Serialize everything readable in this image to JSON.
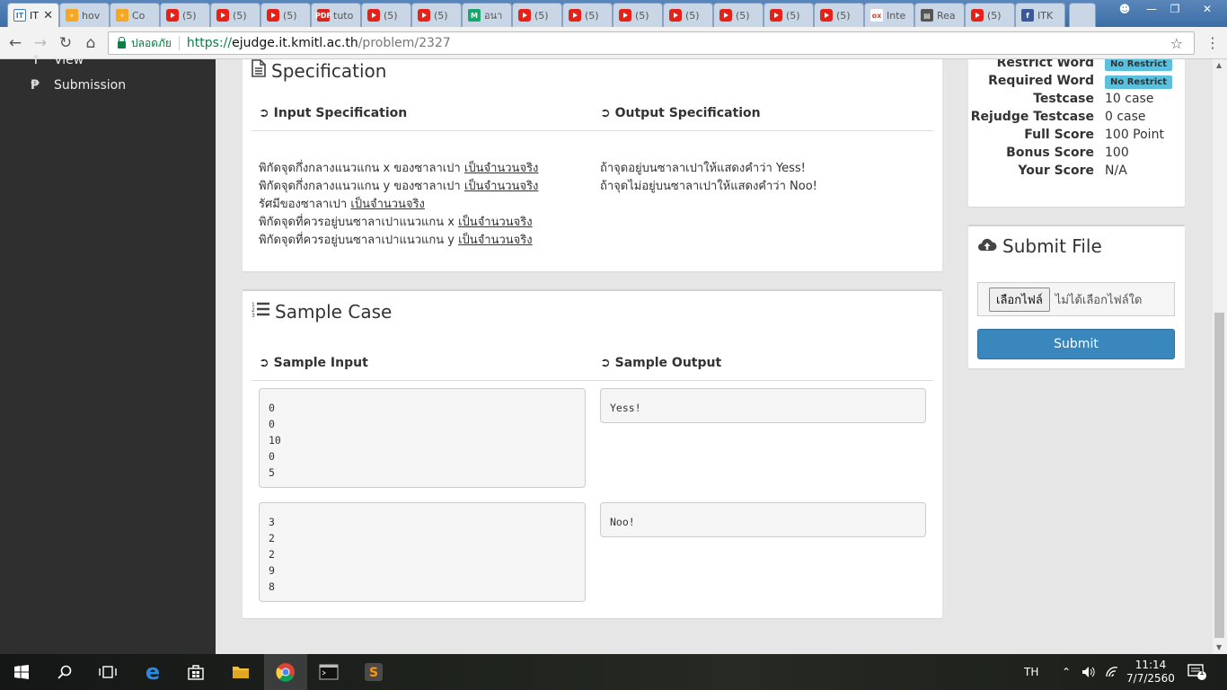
{
  "browser": {
    "tabs": [
      {
        "title": "IT",
        "icon": "it-icon",
        "active": true
      },
      {
        "title": "hov",
        "icon": "orange-icon"
      },
      {
        "title": "Co",
        "icon": "orange-icon"
      },
      {
        "title": "(5)",
        "icon": "youtube-icon"
      },
      {
        "title": "(5)",
        "icon": "youtube-icon"
      },
      {
        "title": "(5)",
        "icon": "youtube-icon"
      },
      {
        "title": "tuto",
        "icon": "pdf-icon"
      },
      {
        "title": "(5)",
        "icon": "youtube-icon"
      },
      {
        "title": "(5)",
        "icon": "youtube-icon"
      },
      {
        "title": "อนา",
        "icon": "medium-icon"
      },
      {
        "title": "(5)",
        "icon": "youtube-icon"
      },
      {
        "title": "(5)",
        "icon": "youtube-icon"
      },
      {
        "title": "(5)",
        "icon": "youtube-icon"
      },
      {
        "title": "(5)",
        "icon": "youtube-icon"
      },
      {
        "title": "(5)",
        "icon": "youtube-icon"
      },
      {
        "title": "(5)",
        "icon": "youtube-icon"
      },
      {
        "title": "(5)",
        "icon": "youtube-icon"
      },
      {
        "title": "Inte",
        "icon": "ox-icon"
      },
      {
        "title": "Rea",
        "icon": "doc-icon"
      },
      {
        "title": "(5)",
        "icon": "youtube-icon"
      },
      {
        "title": "ITK",
        "icon": "facebook-icon"
      }
    ],
    "secure_label": "ปลอดภัย",
    "url_scheme": "https://",
    "url_host": "ejudge.it.kmitl.ac.th",
    "url_path": "/problem/2327"
  },
  "sidebar": {
    "items": [
      {
        "icon": "view-icon",
        "label": "View"
      },
      {
        "icon": "p-icon",
        "label": "Submission"
      }
    ]
  },
  "specification": {
    "title": "Specification",
    "input_header": "Input Specification",
    "output_header": "Output Specification",
    "input_lines": [
      {
        "text": "พิกัดจุดกึ่งกลางแนวแกน x ของซาลาเปา ",
        "u": "เป็นจำนวนจริง"
      },
      {
        "text": "พิกัดจุดกึ่งกลางแนวแกน y ของซาลาเปา ",
        "u": "เป็นจำนวนจริง"
      },
      {
        "text": "รัศมีของซาลาเปา ",
        "u": "เป็นจำนวนจริง"
      },
      {
        "text": "พิกัดจุดที่ควรอยู่บนซาลาเปาแนวแกน x ",
        "u": "เป็นจำนวนจริง"
      },
      {
        "text": "พิกัดจุดที่ควรอยู่บนซาลาเปาแนวแกน y ",
        "u": "เป็นจำนวนจริง"
      }
    ],
    "output_lines": [
      "ถ้าจุดอยู่บนซาลาเปาให้แสดงคำว่า Yess!",
      "ถ้าจุดไม่อยู่บนซาลาเปาให้แสดงคำว่า Noo!"
    ]
  },
  "sample": {
    "title": "Sample Case",
    "input_header": "Sample Input",
    "output_header": "Sample Output",
    "cases": [
      {
        "input": "0\n0\n10\n0\n5",
        "output": "Yess!"
      },
      {
        "input": "3\n2\n2\n9\n8",
        "output": "Noo!"
      }
    ]
  },
  "info": {
    "rows": [
      {
        "label": "Restrict Word",
        "value": "No Restrict",
        "badge": true
      },
      {
        "label": "Required Word",
        "value": "No Restrict",
        "badge": true
      },
      {
        "label": "Testcase",
        "value": "10 case"
      },
      {
        "label": "Rejudge Testcase",
        "value": "0 case"
      },
      {
        "label": "Full Score",
        "value": "100 Point"
      },
      {
        "label": "Bonus Score",
        "value": "100"
      },
      {
        "label": "Your Score",
        "value": "N/A"
      }
    ]
  },
  "submit": {
    "title": "Submit File",
    "choose_file": "เลือกไฟล์",
    "no_file": "ไม่ได้เลือกไฟล์ใด",
    "button": "Submit"
  },
  "taskbar": {
    "lang": "TH",
    "time": "11:14",
    "date": "7/7/2560",
    "notifications": "1"
  }
}
